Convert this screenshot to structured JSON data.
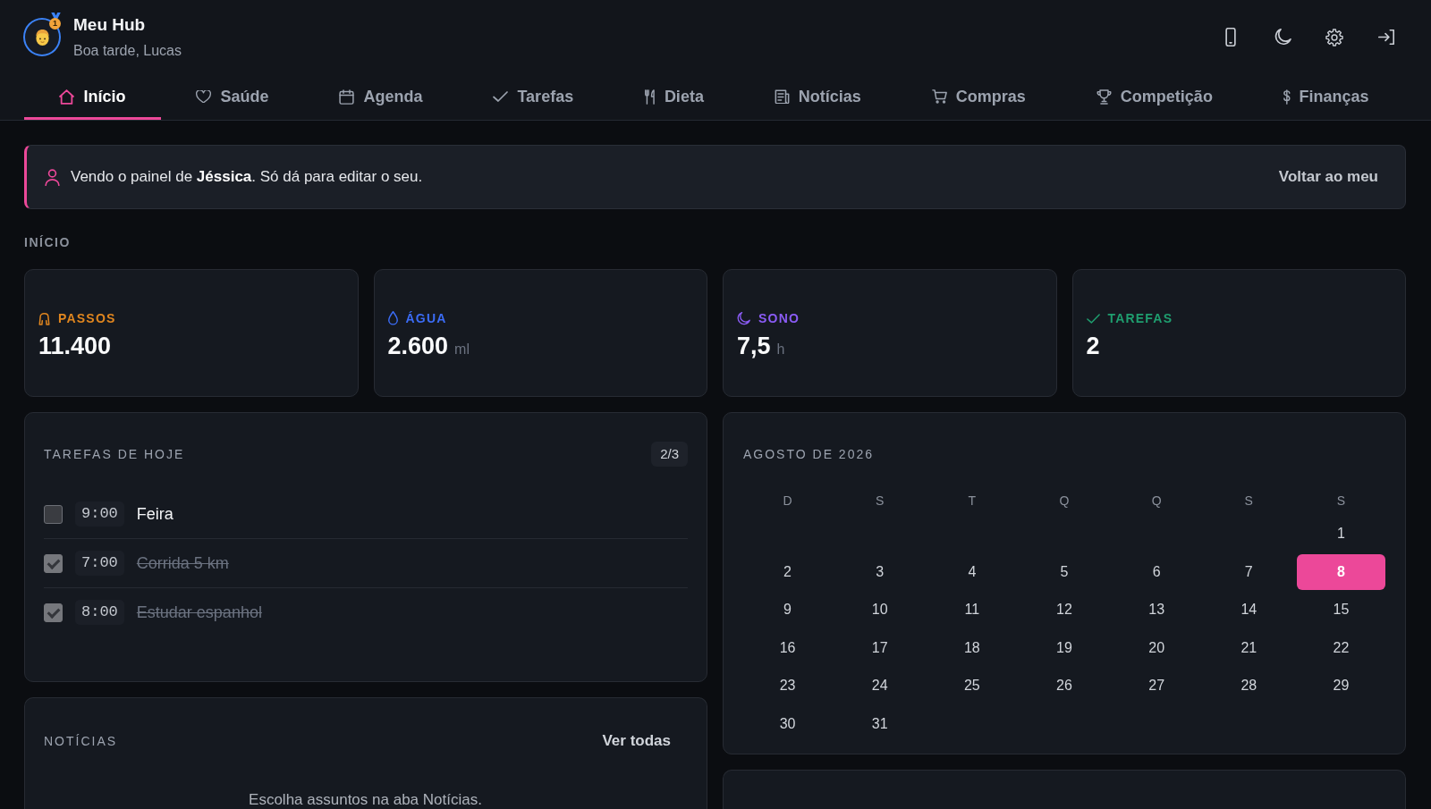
{
  "header": {
    "title": "Meu Hub",
    "subtitle": "Boa tarde, Lucas",
    "medal": "1"
  },
  "tabs": [
    {
      "label": "Início",
      "selected": true
    },
    {
      "label": "Saúde",
      "selected": false
    },
    {
      "label": "Agenda",
      "selected": false
    },
    {
      "label": "Tarefas",
      "selected": false
    },
    {
      "label": "Dieta",
      "selected": false
    },
    {
      "label": "Notícias",
      "selected": false
    },
    {
      "label": "Compras",
      "selected": false
    },
    {
      "label": "Competição",
      "selected": false
    },
    {
      "label": "Finanças",
      "selected": false
    }
  ],
  "banner": {
    "text": "Vendo o painel de **Jéssica**. Só dá para editar o seu.",
    "action": "Voltar ao meu"
  },
  "section_title": "INÍCIO",
  "stats": [
    {
      "label": "PASSOS",
      "value": "11.400",
      "color": "#e0861f"
    },
    {
      "label": "ÁGUA",
      "value": "2.600",
      "unit": "ml",
      "color": "#3b6cf6"
    },
    {
      "label": "SONO",
      "value": "7,5",
      "unit": "h",
      "color": "#8b5cf6"
    },
    {
      "label": "TAREFAS",
      "value": "2",
      "color": "#1f9e6f"
    }
  ],
  "tasks": {
    "title": "TAREFAS DE HOJE",
    "count": "2/3",
    "items": [
      {
        "time": "9:00",
        "title": "Feira",
        "checked": false
      },
      {
        "time": "7:00",
        "title": "Corrida 5 km",
        "checked": true
      },
      {
        "time": "8:00",
        "title": "Estudar espanhol",
        "checked": true
      }
    ]
  },
  "news": {
    "title": "NOTÍCIAS",
    "link": "Ver todas",
    "empty_message": "Escolha assuntos na aba Notícias."
  },
  "calendar": {
    "title": "AGOSTO DE 2026",
    "weekdays": [
      "D",
      "S",
      "T",
      "Q",
      "Q",
      "S",
      "S"
    ],
    "weeks": [
      [
        {
          "day": "1",
          "selected": false
        }
      ],
      [
        {
          "day": "2",
          "selected": false
        },
        {
          "day": "3",
          "selected": false
        },
        {
          "day": "4",
          "selected": false
        },
        {
          "day": "5",
          "selected": false
        },
        {
          "day": "6",
          "selected": false
        },
        {
          "day": "7",
          "selected": false
        },
        {
          "day": "8",
          "selected": true
        }
      ],
      [
        {
          "day": "9",
          "selected": false
        },
        {
          "day": "10",
          "selected": false
        },
        {
          "day": "11",
          "selected": false
        },
        {
          "day": "12",
          "selected": false
        },
        {
          "day": "13",
          "selected": false
        },
        {
          "day": "14",
          "selected": false
        },
        {
          "day": "15",
          "selected": false
        }
      ],
      [
        {
          "day": "16",
          "selected": false
        },
        {
          "day": "17",
          "selected": false
        },
        {
          "day": "18",
          "selected": false
        },
        {
          "day": "19",
          "selected": false
        },
        {
          "day": "20",
          "selected": false
        },
        {
          "day": "21",
          "selected": false
        },
        {
          "day": "22",
          "selected": false
        }
      ],
      [
        {
          "day": "23",
          "selected": false
        },
        {
          "day": "24",
          "selected": false
        },
        {
          "day": "25",
          "selected": false
        },
        {
          "day": "26",
          "selected": false
        },
        {
          "day": "27",
          "selected": false
        },
        {
          "day": "28",
          "selected": false
        },
        {
          "day": "29",
          "selected": false
        }
      ],
      [
        {
          "day": "30",
          "selected": false
        },
        {
          "day": "31",
          "selected": false
        }
      ]
    ]
  }
}
